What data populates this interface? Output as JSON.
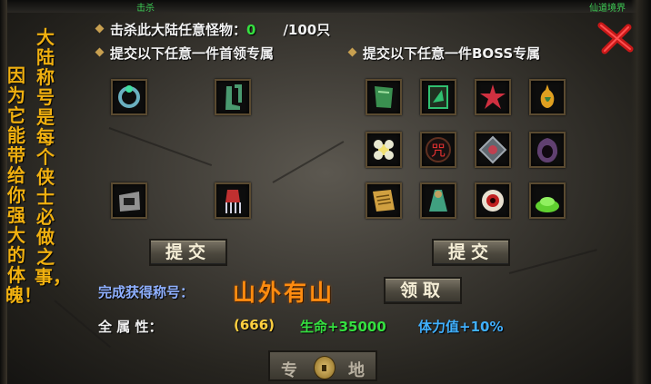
{
  "top_bar": {
    "left_text": "击杀",
    "right_text": "仙道境界"
  },
  "left_vertical_1": "因为它能带给你强大的体魄！",
  "left_vertical_2": "大陆称号是每个侠士必做之事，",
  "kill_row": {
    "label": "击杀此大陆任意怪物：",
    "current": "0",
    "total": "/100只"
  },
  "submit_row_left": "提交以下任意一件首领专属",
  "submit_row_right": "提交以下任意一件BOSS专属",
  "left_items": [
    {
      "name": "emerald-ring-icon",
      "color": "#6ab0c0"
    },
    {
      "name": "boots-icon",
      "color": "#4a9a70"
    },
    {
      "name": "silver-ring-icon",
      "color": "#a0a0a0"
    },
    {
      "name": "claw-glove-icon",
      "color": "#c03030"
    }
  ],
  "right_items": [
    {
      "name": "jade-plaque-icon",
      "color": "#3a9050"
    },
    {
      "name": "green-card-icon",
      "color": "#30c070"
    },
    {
      "name": "red-star-icon",
      "color": "#d03040"
    },
    {
      "name": "gourd-icon",
      "color": "#e0a020"
    },
    {
      "name": "flower-icon",
      "color": "#e8e8d0"
    },
    {
      "name": "curse-seal-icon",
      "color": "#e03030"
    },
    {
      "name": "gem-box-icon",
      "color": "#c04050"
    },
    {
      "name": "dark-hood-icon",
      "color": "#604070"
    },
    {
      "name": "scroll-icon",
      "color": "#d0a040"
    },
    {
      "name": "jade-figure-icon",
      "color": "#40a080"
    },
    {
      "name": "red-eye-icon",
      "color": "#c02020"
    },
    {
      "name": "green-powder-icon",
      "color": "#60d030"
    }
  ],
  "buttons": {
    "submit_left": "提交",
    "submit_right": "提交",
    "claim": "领取"
  },
  "reward": {
    "label": "完成获得称号：",
    "title": "山外有山"
  },
  "stats": {
    "label": "全  属  性：",
    "score": "(666)",
    "hp": "生命+35000",
    "stamina": "体力值+10%"
  },
  "special_button": {
    "left": "专",
    "right": "地"
  }
}
